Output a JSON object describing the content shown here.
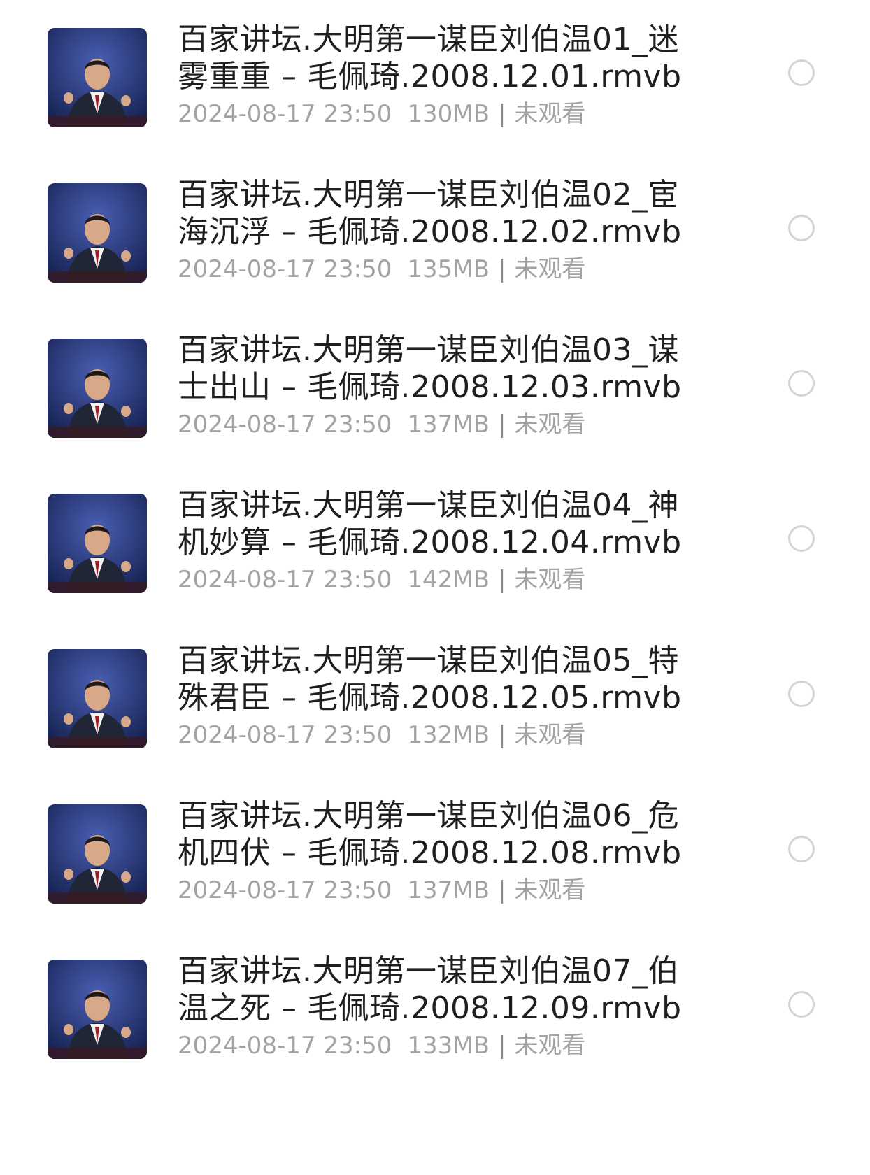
{
  "colors": {
    "title": "#1f1f1f",
    "meta": "#a3a3a3",
    "radio_border": "#d4d4d4",
    "thumb_bg": "#1f2d6a"
  },
  "items": [
    {
      "title": "百家讲坛.大明第一谋臣刘伯温01_迷雾重重 – 毛佩琦.2008.12.01.rmvb",
      "date": "2024-08-17 23:50",
      "size": "130MB",
      "separator": "|",
      "status": "未观看",
      "thumb_icon": "video-thumbnail",
      "selected": false
    },
    {
      "title": "百家讲坛.大明第一谋臣刘伯温02_宦海沉浮 – 毛佩琦.2008.12.02.rmvb",
      "date": "2024-08-17 23:50",
      "size": "135MB",
      "separator": "|",
      "status": "未观看",
      "thumb_icon": "video-thumbnail",
      "selected": false
    },
    {
      "title": "百家讲坛.大明第一谋臣刘伯温03_谋士出山 – 毛佩琦.2008.12.03.rmvb",
      "date": "2024-08-17 23:50",
      "size": "137MB",
      "separator": "|",
      "status": "未观看",
      "thumb_icon": "video-thumbnail",
      "selected": false
    },
    {
      "title": "百家讲坛.大明第一谋臣刘伯温04_神机妙算 – 毛佩琦.2008.12.04.rmvb",
      "date": "2024-08-17 23:50",
      "size": "142MB",
      "separator": "|",
      "status": "未观看",
      "thumb_icon": "video-thumbnail",
      "selected": false
    },
    {
      "title": "百家讲坛.大明第一谋臣刘伯温05_特殊君臣 – 毛佩琦.2008.12.05.rmvb",
      "date": "2024-08-17 23:50",
      "size": "132MB",
      "separator": "|",
      "status": "未观看",
      "thumb_icon": "video-thumbnail",
      "selected": false
    },
    {
      "title": "百家讲坛.大明第一谋臣刘伯温06_危机四伏 – 毛佩琦.2008.12.08.rmvb",
      "date": "2024-08-17 23:50",
      "size": "137MB",
      "separator": "|",
      "status": "未观看",
      "thumb_icon": "video-thumbnail",
      "selected": false
    },
    {
      "title": "百家讲坛.大明第一谋臣刘伯温07_伯温之死 – 毛佩琦.2008.12.09.rmvb",
      "date": "2024-08-17 23:50",
      "size": "133MB",
      "separator": "|",
      "status": "未观看",
      "thumb_icon": "video-thumbnail",
      "selected": false
    }
  ]
}
